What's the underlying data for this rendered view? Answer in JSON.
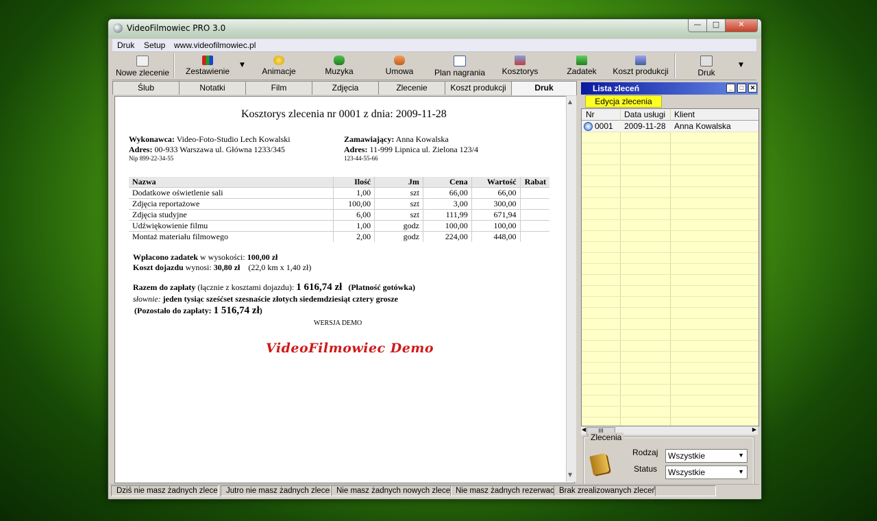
{
  "window": {
    "title": "VideoFilmowiec  PRO 3.0"
  },
  "menu": {
    "items": [
      "Druk",
      "Setup",
      "www.videofilmowiec.pl"
    ]
  },
  "toolbar": {
    "buttons": [
      "Nowe zlecenie",
      "Zestawienie",
      "Animacje",
      "Muzyka",
      "Umowa",
      "Plan nagrania",
      "Kosztorys",
      "Zadatek",
      "Koszt produkcji",
      "Druk"
    ]
  },
  "tabs": [
    "Ślub",
    "Notatki",
    "Film",
    "Zdjęcia",
    "Zlecenie",
    "Koszt produkcji",
    "Druk"
  ],
  "document": {
    "heading": "Kosztorys zlecenia nr 0001 z dnia: 2009-11-28",
    "contractor_label": "Wykonawca:",
    "contractor_name": "Video-Foto-Studio Lech Kowalski",
    "contractor_address_label": "Adres:",
    "contractor_address": "00-933 Warszawa ul. Główna 1233/345",
    "contractor_nip": "Nip 899-22-34-55",
    "client_label": "Zamawiający:",
    "client_name": "Anna Kowalska",
    "client_address_label": "Adres:",
    "client_address": "11-999 Lipnica ul. Zielona 123/4",
    "client_phone": "123-44-55-66",
    "table": {
      "headers": [
        "Nazwa",
        "Ilość",
        "Jm",
        "Cena",
        "Wartość",
        "Rabat"
      ],
      "rows": [
        [
          "Dodatkowe oświetlenie sali",
          "1,00",
          "szt",
          "66,00",
          "66,00",
          ""
        ],
        [
          "Zdjęcia reportażowe",
          "100,00",
          "szt",
          "3,00",
          "300,00",
          ""
        ],
        [
          "Zdjęcia studyjne",
          "6,00",
          "szt",
          "111,99",
          "671,94",
          ""
        ],
        [
          "Udźwiękowienie filmu",
          "1,00",
          "godz",
          "100,00",
          "100,00",
          ""
        ],
        [
          "Montaż materiału filmowego",
          "2,00",
          "godz",
          "224,00",
          "448,00",
          ""
        ]
      ]
    },
    "deposit_label": "Wpłacono zadatek",
    "deposit_mid": " w wysokości: ",
    "deposit_value": "100,00 zł",
    "travel_label": "Koszt dojazdu",
    "travel_mid": " wynosi: ",
    "travel_value": "30,80 zł",
    "travel_detail": "(22,0 km x 1,40 zł)",
    "total_label": "Razem do zapłaty",
    "total_mid": " (łącznie z kosztami dojazdu): ",
    "total_value": "1 616,74 zł",
    "payment": "(Płatność gotówka)",
    "words_label": "słownie:",
    "words_value": "jeden tysiąc sześćset szesnaście złotych siedemdziesiąt cztery grosze",
    "remaining_label": "(Pozostało do zapłaty:",
    "remaining_value": "1 516,74 zł",
    "remaining_close": ")",
    "demo_version": "WERSJA DEMO",
    "demo_logo": "VideoFilmowiec   Demo"
  },
  "side_panel": {
    "title": "Lista zleceń",
    "edit_button": "Edycja zlecenia",
    "columns": [
      "Nr",
      "Data usługi",
      "Klient"
    ],
    "rows": [
      [
        "0001",
        "2009-11-28",
        "Anna Kowalska"
      ]
    ],
    "scroll_thumb": "III",
    "filters": {
      "legend": "Zlecenia",
      "rodzaj_label": "Rodzaj",
      "rodzaj_value": "Wszystkie",
      "status_label": "Status",
      "status_value": "Wszystkie"
    }
  },
  "statusbar": [
    "Dziś nie masz żadnych zleceń",
    "Jutro nie masz żadnych zleceń",
    "Nie masz żadnych nowych zleceń",
    "Nie masz żadnych rezerwacji",
    "Brak zrealizowanych zleceń"
  ]
}
